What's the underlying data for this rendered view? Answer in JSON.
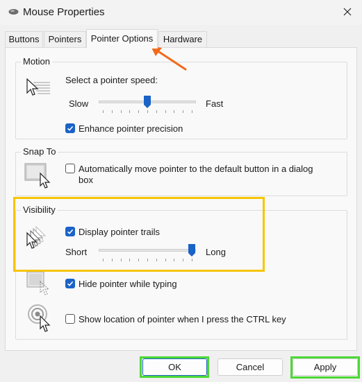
{
  "window": {
    "title": "Mouse Properties"
  },
  "tabs": [
    "Buttons",
    "Pointers",
    "Pointer Options",
    "Hardware"
  ],
  "motion": {
    "group_label": "Motion",
    "speed_label": "Select a pointer speed:",
    "slow_label": "Slow",
    "fast_label": "Fast",
    "speed_fraction": 0.5,
    "enhance_label": "Enhance pointer precision",
    "enhance_checked": true
  },
  "snap_to": {
    "group_label": "Snap To",
    "line1": "Automatically move pointer to the default button in a dialog",
    "line2": "box",
    "checked": false
  },
  "visibility": {
    "group_label": "Visibility",
    "trails_label": "Display pointer trails",
    "trails_checked": true,
    "short_label": "Short",
    "long_label": "Long",
    "trail_fraction": 1.0,
    "hide_label": "Hide pointer while typing",
    "hide_checked": true,
    "ctrl_label": "Show location of pointer when I press the CTRL key",
    "ctrl_checked": false
  },
  "buttons": {
    "ok": "OK",
    "cancel": "Cancel",
    "apply": "Apply"
  },
  "colors": {
    "accent": "#1a63c8",
    "highlight_yellow": "#f7c500",
    "highlight_green": "#4cd835",
    "arrow": "#f26a1b"
  },
  "icons": {
    "title": "mouse-icon",
    "close": "close-icon",
    "motion": "pointer-speed-icon",
    "snap": "snap-to-icon",
    "trails": "pointer-trails-icon",
    "hide": "hide-pointer-icon",
    "ctrl": "pointer-location-icon"
  }
}
